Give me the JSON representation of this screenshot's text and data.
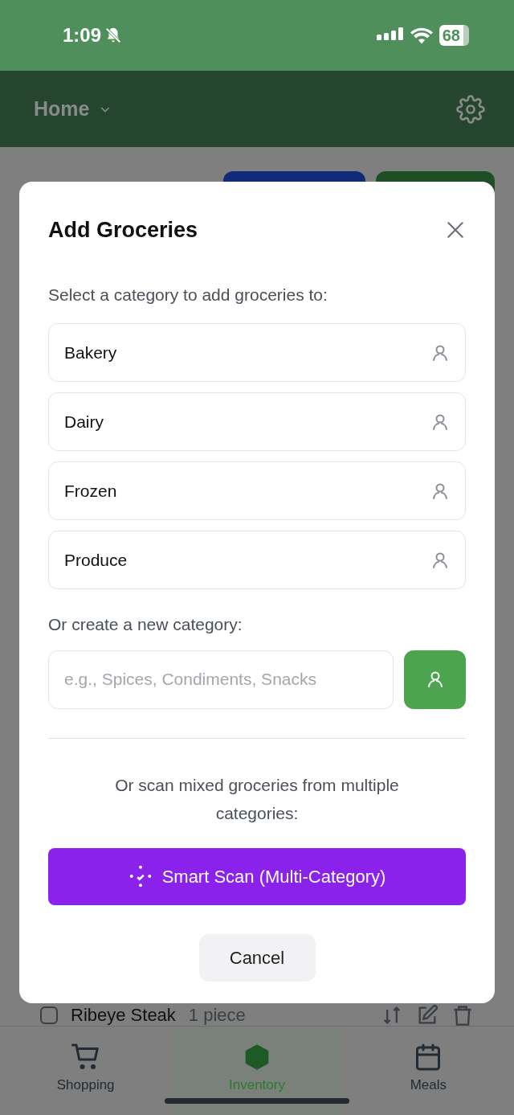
{
  "status_bar": {
    "time": "1:09",
    "battery": "68"
  },
  "header": {
    "title": "Home"
  },
  "background": {
    "item": {
      "name": "Ribeye Steak",
      "quantity": "1 piece",
      "checked": false
    }
  },
  "dialog": {
    "title": "Add Groceries",
    "prompt": "Select a category to add groceries to:",
    "categories": [
      "Bakery",
      "Dairy",
      "Frozen",
      "Produce"
    ],
    "new_category_label": "Or create a new category:",
    "new_category_placeholder": "e.g., Spices, Condiments, Snacks",
    "scan_prompt": "Or scan mixed groceries from multiple categories:",
    "scan_button": "Smart Scan (Multi-Category)",
    "cancel_button": "Cancel"
  },
  "tabs": [
    {
      "label": "Shopping",
      "kind": "cart",
      "selected": false
    },
    {
      "label": "Inventory",
      "kind": "box",
      "selected": true
    },
    {
      "label": "Meals",
      "kind": "calendar",
      "selected": false
    }
  ]
}
